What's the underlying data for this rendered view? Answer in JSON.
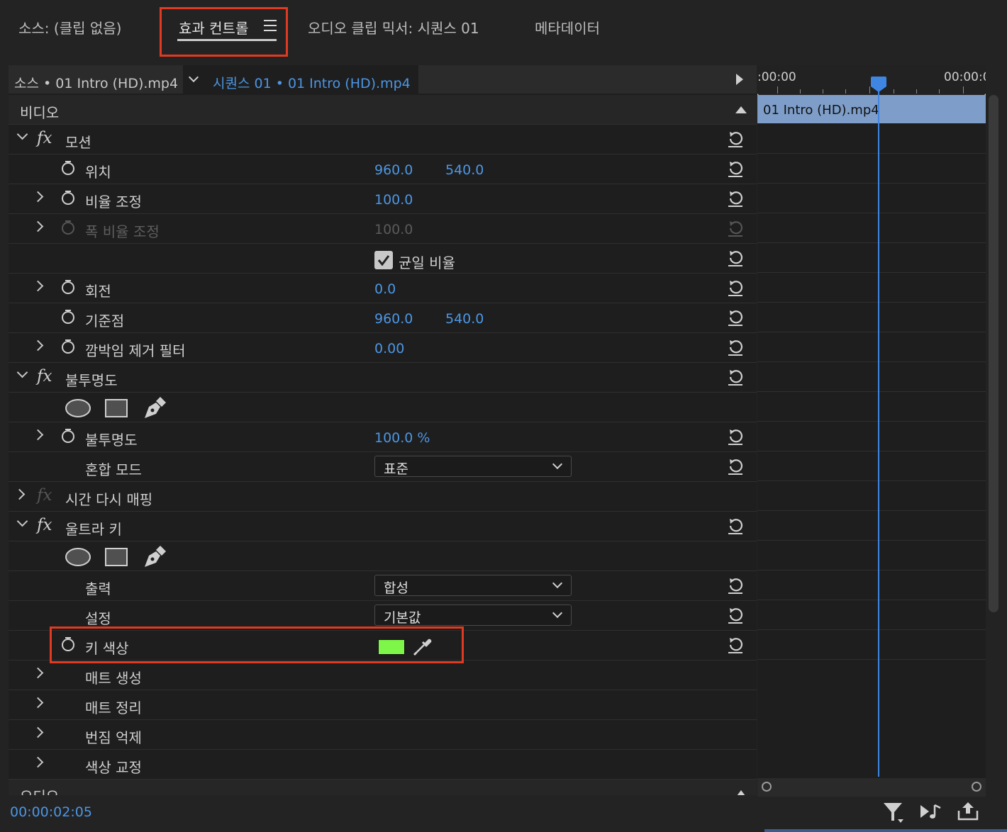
{
  "tabs": [
    {
      "label": "소스: (클립 없음)",
      "active": false
    },
    {
      "label": "효과 컨트롤",
      "active": true
    },
    {
      "label": "오디오 클립 믹서: 시퀀스 01",
      "active": false
    },
    {
      "label": "메타데이터",
      "active": false
    }
  ],
  "source_bar": {
    "source_label": "소스 • 01 Intro (HD).mp4",
    "sequence_label": "시퀀스 01 • 01 Intro (HD).mp4"
  },
  "sections": {
    "video": "비디오",
    "audio": "오디오"
  },
  "motion": {
    "title": "모션",
    "position": {
      "label": "위치",
      "x": "960.0",
      "y": "540.0"
    },
    "scale": {
      "label": "비율 조정",
      "value": "100.0"
    },
    "scale_width": {
      "label": "폭 비율 조정",
      "value": "100.0"
    },
    "uniform_scale": {
      "label": "균일 비율",
      "checked": true
    },
    "rotation": {
      "label": "회전",
      "value": "0.0"
    },
    "anchor": {
      "label": "기준점",
      "x": "960.0",
      "y": "540.0"
    },
    "flicker": {
      "label": "깜박임 제거 필터",
      "value": "0.00"
    }
  },
  "opacity": {
    "title": "불투명도",
    "opacity": {
      "label": "불투명도",
      "value": "100.0 %"
    },
    "blend": {
      "label": "혼합 모드",
      "value": "표준"
    }
  },
  "time_remap": {
    "title": "시간 다시 매핑"
  },
  "ultra_key": {
    "title": "울트라 키",
    "output": {
      "label": "출력",
      "value": "합성"
    },
    "setting": {
      "label": "설정",
      "value": "기본값"
    },
    "key_color": {
      "label": "키 색상",
      "color": "#7df549"
    },
    "matte_generation": "매트 생성",
    "matte_cleanup": "매트 정리",
    "spill_suppression": "번짐 억제",
    "color_correction": "색상 교정"
  },
  "timeline": {
    "ruler_left": ":00:00",
    "ruler_right": "00:00:0",
    "clip_name": "01 Intro (HD).mp4"
  },
  "footer": {
    "timecode": "00:00:02:05"
  },
  "colors": {
    "accent_blue": "#4c96e4",
    "highlight_red": "#e03a22",
    "clip_bar": "#7e9ec9"
  }
}
